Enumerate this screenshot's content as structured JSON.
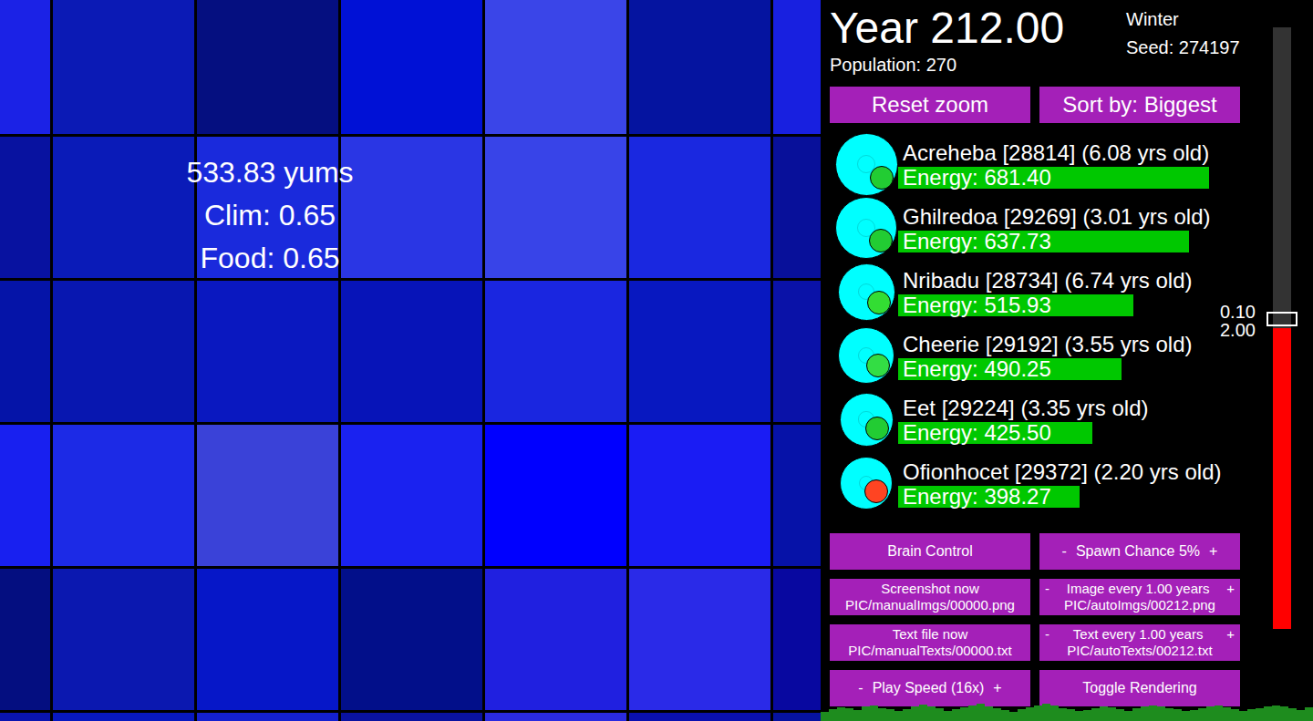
{
  "map": {
    "tiles": [
      [
        {
          "color": "#1b22e6"
        },
        {
          "color": "#0b1ab5"
        },
        {
          "color": "#050f80"
        },
        {
          "color": "#0011d6"
        },
        {
          "color": "#3a45e8"
        },
        {
          "color": "#0514a0"
        },
        {
          "color": "#1820e0"
        }
      ],
      [
        {
          "color": "#0812a0"
        },
        {
          "color": "#0a1bb8"
        },
        {
          "color": "#1a2adc"
        },
        {
          "color": "#2a36e4"
        },
        {
          "color": "#3844e8"
        },
        {
          "color": "#1a28e0"
        },
        {
          "color": "#08109a"
        }
      ],
      [
        {
          "color": "#0514a8"
        },
        {
          "color": "#0817b0"
        },
        {
          "color": "#0a18c0"
        },
        {
          "color": "#0714b8"
        },
        {
          "color": "#1a26e0"
        },
        {
          "color": "#0818c0"
        },
        {
          "color": "#0a12a8"
        }
      ],
      [
        {
          "color": "#1820f0"
        },
        {
          "color": "#1c2ae6"
        },
        {
          "color": "#3a42d8"
        },
        {
          "color": "#1a22f0"
        },
        {
          "color": "#0000ff"
        },
        {
          "color": "#1a1cf4"
        },
        {
          "color": "#0612a8"
        }
      ],
      [
        {
          "color": "#040e80"
        },
        {
          "color": "#0b18b0"
        },
        {
          "color": "#0617c8"
        },
        {
          "color": "#020f8a"
        },
        {
          "color": "#2020e0"
        },
        {
          "color": "#2a2ae8"
        },
        {
          "color": "#0808a0"
        }
      ],
      [
        {
          "color": "#0a14b0"
        },
        {
          "color": "#0818c0"
        },
        {
          "color": "#1420d0"
        },
        {
          "color": "#0a12a0"
        },
        {
          "color": "#2a2ae0"
        },
        {
          "color": "#0a10b0"
        },
        {
          "color": "#0612a0"
        }
      ]
    ],
    "tooltip": {
      "lines": [
        "533.83 yums",
        "Clim: 0.65",
        "Food: 0.65"
      ]
    }
  },
  "header": {
    "year": "Year 212.00",
    "population": "Population: 270",
    "season": "Winter",
    "seed": "Seed: 274197"
  },
  "top_buttons": [
    "Reset zoom",
    "Sort by: Biggest"
  ],
  "creatures": [
    {
      "name": "Acreheba [28814] (6.08 yrs old)",
      "energy": "Energy: 681.40",
      "level": 0.681,
      "color": "#22cc33"
    },
    {
      "name": "Ghilredoa [29269] (3.01 yrs old)",
      "energy": "Energy: 637.73",
      "level": 0.638,
      "color": "#22cc33"
    },
    {
      "name": "Nribadu [28734] (6.74 yrs old)",
      "energy": "Energy: 515.93",
      "level": 0.516,
      "color": "#33dd33"
    },
    {
      "name": "Cheerie [29192] (3.55 yrs old)",
      "energy": "Energy: 490.25",
      "level": 0.49,
      "color": "#33dd44"
    },
    {
      "name": "Eet [29224] (3.35 yrs old)",
      "energy": "Energy: 425.50",
      "level": 0.426,
      "color": "#22cc33"
    },
    {
      "name": "Ofionhocet [29372] (2.20 yrs old)",
      "energy": "Energy: 398.27",
      "level": 0.398,
      "color": "#ff4422"
    }
  ],
  "controls": [
    {
      "label": "Brain Control"
    },
    {
      "minus": "-",
      "label": "Spawn Chance 5%",
      "plus": "+"
    },
    {
      "label": "Screenshot now",
      "sub": "PIC/manualImgs/00000.png"
    },
    {
      "minus": "-",
      "label": "Image every 1.00 years",
      "plus": "+",
      "sub": "PIC/autoImgs/00212.png"
    },
    {
      "label": "Text file now",
      "sub": "PIC/manualTexts/00000.txt"
    },
    {
      "minus": "-",
      "label": "Text every 1.00 years",
      "plus": "+",
      "sub": "PIC/autoTexts/00212.txt"
    },
    {
      "minus": "-",
      "label": "Play Speed (16x)",
      "plus": "+"
    },
    {
      "label": "Toggle Rendering"
    }
  ],
  "speed_slider": {
    "level": 0.5,
    "labels": [
      "0.10",
      "2.00"
    ]
  },
  "population_graph": {
    "values": [
      262,
      266,
      270,
      268,
      265,
      271,
      274,
      269,
      266,
      263,
      267,
      272,
      275,
      271,
      268,
      264,
      266,
      270,
      273,
      276,
      272,
      268,
      265,
      262,
      266,
      270,
      274,
      277,
      273,
      269,
      266,
      263,
      265,
      269,
      272,
      270,
      267,
      264,
      268,
      271,
      274,
      272,
      269,
      266,
      263,
      265,
      268,
      271,
      273,
      270,
      267,
      264,
      266,
      269,
      272,
      274,
      271,
      268,
      265,
      270
    ]
  }
}
